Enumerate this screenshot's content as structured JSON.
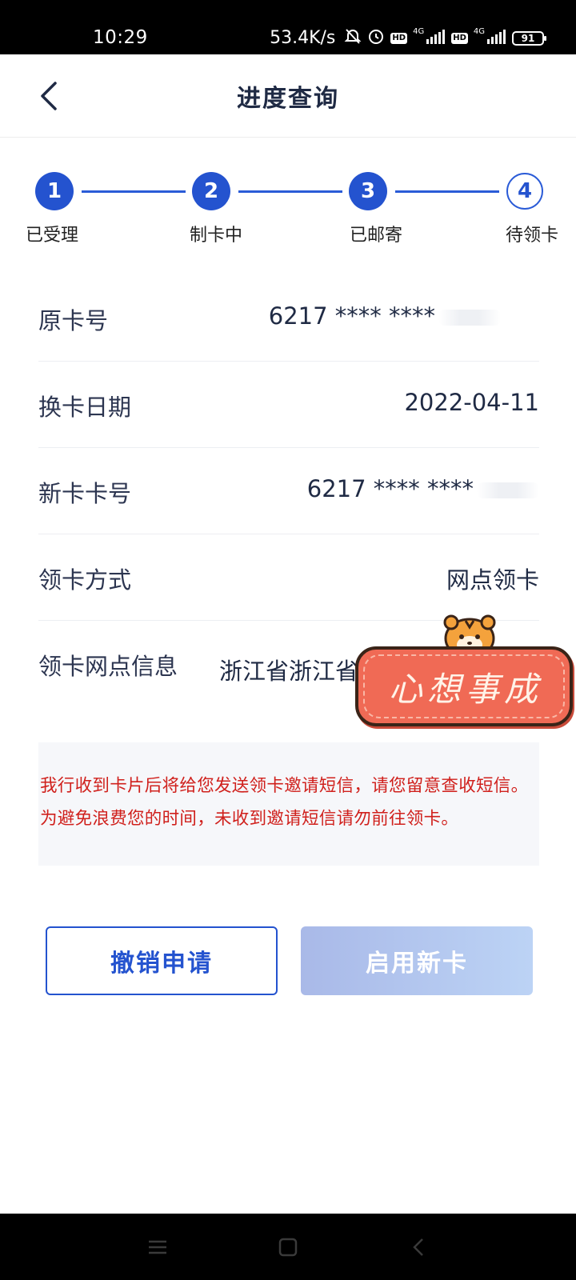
{
  "status_bar": {
    "time": "10:29",
    "speed": "53.4K/s",
    "hd": "HD",
    "network_1": "4G",
    "network_2": "4G",
    "battery": "91"
  },
  "header": {
    "title": "进度查询",
    "back_icon": "chevron-left-icon"
  },
  "steps": [
    {
      "number": "1",
      "label": "已受理",
      "state": "done"
    },
    {
      "number": "2",
      "label": "制卡中",
      "state": "done"
    },
    {
      "number": "3",
      "label": "已邮寄",
      "state": "done"
    },
    {
      "number": "4",
      "label": "待领卡",
      "state": "pending"
    }
  ],
  "info": {
    "original_card_label": "原卡号",
    "original_card_value": "6217 **** ****",
    "exchange_date_label": "换卡日期",
    "exchange_date_value": "2022-04-11",
    "new_card_label": "新卡卡号",
    "new_card_value": "6217 **** ****",
    "pickup_method_label": "领卡方式",
    "pickup_method_value": "网点领卡",
    "outlet_label": "领卡网点信息",
    "outlet_value": "浙江省浙江省"
  },
  "sticker": {
    "text": "心想事成"
  },
  "notice": {
    "text": "我行收到卡片后将给您发送领卡邀请短信，请您留意查收短信。为避免浪费您的时间，未收到邀请短信请勿前往领卡。"
  },
  "buttons": {
    "cancel_label": "撤销申请",
    "activate_label": "启用新卡"
  },
  "colors": {
    "primary": "#2453cf",
    "notice_text": "#d0201c",
    "disabled_button": "#b3c5ee"
  }
}
